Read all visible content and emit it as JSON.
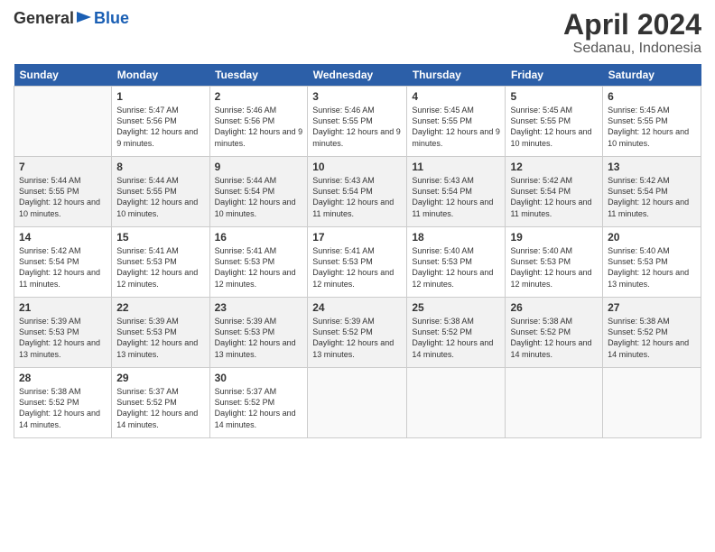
{
  "header": {
    "logo_general": "General",
    "logo_blue": "Blue",
    "month": "April 2024",
    "location": "Sedanau, Indonesia"
  },
  "days_of_week": [
    "Sunday",
    "Monday",
    "Tuesday",
    "Wednesday",
    "Thursday",
    "Friday",
    "Saturday"
  ],
  "weeks": [
    [
      {
        "day": "",
        "empty": true
      },
      {
        "day": "1",
        "sunrise": "Sunrise: 5:47 AM",
        "sunset": "Sunset: 5:56 PM",
        "daylight": "Daylight: 12 hours and 9 minutes."
      },
      {
        "day": "2",
        "sunrise": "Sunrise: 5:46 AM",
        "sunset": "Sunset: 5:56 PM",
        "daylight": "Daylight: 12 hours and 9 minutes."
      },
      {
        "day": "3",
        "sunrise": "Sunrise: 5:46 AM",
        "sunset": "Sunset: 5:55 PM",
        "daylight": "Daylight: 12 hours and 9 minutes."
      },
      {
        "day": "4",
        "sunrise": "Sunrise: 5:45 AM",
        "sunset": "Sunset: 5:55 PM",
        "daylight": "Daylight: 12 hours and 9 minutes."
      },
      {
        "day": "5",
        "sunrise": "Sunrise: 5:45 AM",
        "sunset": "Sunset: 5:55 PM",
        "daylight": "Daylight: 12 hours and 10 minutes."
      },
      {
        "day": "6",
        "sunrise": "Sunrise: 5:45 AM",
        "sunset": "Sunset: 5:55 PM",
        "daylight": "Daylight: 12 hours and 10 minutes."
      }
    ],
    [
      {
        "day": "7",
        "sunrise": "Sunrise: 5:44 AM",
        "sunset": "Sunset: 5:55 PM",
        "daylight": "Daylight: 12 hours and 10 minutes."
      },
      {
        "day": "8",
        "sunrise": "Sunrise: 5:44 AM",
        "sunset": "Sunset: 5:55 PM",
        "daylight": "Daylight: 12 hours and 10 minutes."
      },
      {
        "day": "9",
        "sunrise": "Sunrise: 5:44 AM",
        "sunset": "Sunset: 5:54 PM",
        "daylight": "Daylight: 12 hours and 10 minutes."
      },
      {
        "day": "10",
        "sunrise": "Sunrise: 5:43 AM",
        "sunset": "Sunset: 5:54 PM",
        "daylight": "Daylight: 12 hours and 11 minutes."
      },
      {
        "day": "11",
        "sunrise": "Sunrise: 5:43 AM",
        "sunset": "Sunset: 5:54 PM",
        "daylight": "Daylight: 12 hours and 11 minutes."
      },
      {
        "day": "12",
        "sunrise": "Sunrise: 5:42 AM",
        "sunset": "Sunset: 5:54 PM",
        "daylight": "Daylight: 12 hours and 11 minutes."
      },
      {
        "day": "13",
        "sunrise": "Sunrise: 5:42 AM",
        "sunset": "Sunset: 5:54 PM",
        "daylight": "Daylight: 12 hours and 11 minutes."
      }
    ],
    [
      {
        "day": "14",
        "sunrise": "Sunrise: 5:42 AM",
        "sunset": "Sunset: 5:54 PM",
        "daylight": "Daylight: 12 hours and 11 minutes."
      },
      {
        "day": "15",
        "sunrise": "Sunrise: 5:41 AM",
        "sunset": "Sunset: 5:53 PM",
        "daylight": "Daylight: 12 hours and 12 minutes."
      },
      {
        "day": "16",
        "sunrise": "Sunrise: 5:41 AM",
        "sunset": "Sunset: 5:53 PM",
        "daylight": "Daylight: 12 hours and 12 minutes."
      },
      {
        "day": "17",
        "sunrise": "Sunrise: 5:41 AM",
        "sunset": "Sunset: 5:53 PM",
        "daylight": "Daylight: 12 hours and 12 minutes."
      },
      {
        "day": "18",
        "sunrise": "Sunrise: 5:40 AM",
        "sunset": "Sunset: 5:53 PM",
        "daylight": "Daylight: 12 hours and 12 minutes."
      },
      {
        "day": "19",
        "sunrise": "Sunrise: 5:40 AM",
        "sunset": "Sunset: 5:53 PM",
        "daylight": "Daylight: 12 hours and 12 minutes."
      },
      {
        "day": "20",
        "sunrise": "Sunrise: 5:40 AM",
        "sunset": "Sunset: 5:53 PM",
        "daylight": "Daylight: 12 hours and 13 minutes."
      }
    ],
    [
      {
        "day": "21",
        "sunrise": "Sunrise: 5:39 AM",
        "sunset": "Sunset: 5:53 PM",
        "daylight": "Daylight: 12 hours and 13 minutes."
      },
      {
        "day": "22",
        "sunrise": "Sunrise: 5:39 AM",
        "sunset": "Sunset: 5:53 PM",
        "daylight": "Daylight: 12 hours and 13 minutes."
      },
      {
        "day": "23",
        "sunrise": "Sunrise: 5:39 AM",
        "sunset": "Sunset: 5:53 PM",
        "daylight": "Daylight: 12 hours and 13 minutes."
      },
      {
        "day": "24",
        "sunrise": "Sunrise: 5:39 AM",
        "sunset": "Sunset: 5:52 PM",
        "daylight": "Daylight: 12 hours and 13 minutes."
      },
      {
        "day": "25",
        "sunrise": "Sunrise: 5:38 AM",
        "sunset": "Sunset: 5:52 PM",
        "daylight": "Daylight: 12 hours and 14 minutes."
      },
      {
        "day": "26",
        "sunrise": "Sunrise: 5:38 AM",
        "sunset": "Sunset: 5:52 PM",
        "daylight": "Daylight: 12 hours and 14 minutes."
      },
      {
        "day": "27",
        "sunrise": "Sunrise: 5:38 AM",
        "sunset": "Sunset: 5:52 PM",
        "daylight": "Daylight: 12 hours and 14 minutes."
      }
    ],
    [
      {
        "day": "28",
        "sunrise": "Sunrise: 5:38 AM",
        "sunset": "Sunset: 5:52 PM",
        "daylight": "Daylight: 12 hours and 14 minutes."
      },
      {
        "day": "29",
        "sunrise": "Sunrise: 5:37 AM",
        "sunset": "Sunset: 5:52 PM",
        "daylight": "Daylight: 12 hours and 14 minutes."
      },
      {
        "day": "30",
        "sunrise": "Sunrise: 5:37 AM",
        "sunset": "Sunset: 5:52 PM",
        "daylight": "Daylight: 12 hours and 14 minutes."
      },
      {
        "day": "",
        "empty": true
      },
      {
        "day": "",
        "empty": true
      },
      {
        "day": "",
        "empty": true
      },
      {
        "day": "",
        "empty": true
      }
    ]
  ]
}
